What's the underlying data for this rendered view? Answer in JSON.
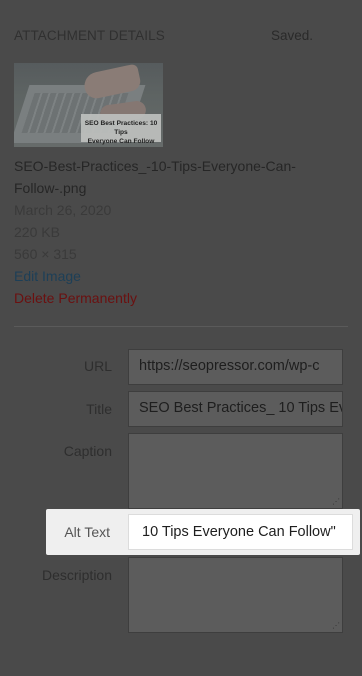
{
  "header": {
    "title": "ATTACHMENT DETAILS",
    "status": "Saved."
  },
  "thumbnail": {
    "caption_line1": "SEO Best Practices: 10 Tips",
    "caption_line2": "Everyone Can Follow"
  },
  "file": {
    "name_line1": "SEO-Best-Practices_-10-Tips-Everyone-Can-",
    "name_line2": "Follow-.png",
    "date": "March 26, 2020",
    "size": "220 KB",
    "dimensions": "560 × 315"
  },
  "actions": {
    "edit": "Edit Image",
    "delete": "Delete Permanently"
  },
  "fields": {
    "url_label": "URL",
    "url_value": "https://seopressor.com/wp-c",
    "title_label": "Title",
    "title_value": "SEO Best Practices_ 10 Tips Ev",
    "caption_label": "Caption",
    "caption_value": "",
    "alt_label": "Alt Text",
    "alt_value": "10 Tips Everyone Can Follow\"",
    "description_label": "Description",
    "description_value": ""
  },
  "colors": {
    "overlay": "#4a4a4a",
    "highlight": "#efefef",
    "delete": "#6b1010",
    "link": "#1d3f57"
  }
}
